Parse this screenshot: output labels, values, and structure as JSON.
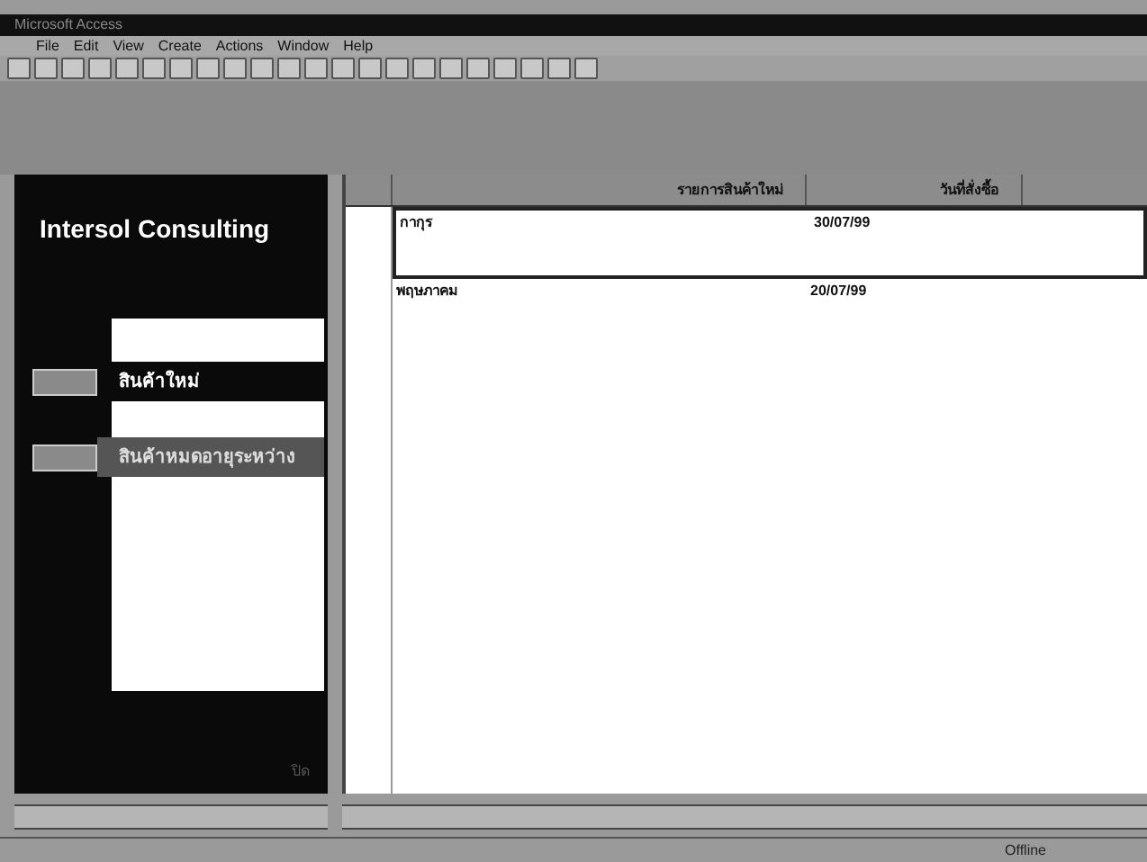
{
  "window": {
    "title": "Microsoft Access"
  },
  "menu": [
    "File",
    "Edit",
    "View",
    "Create",
    "Actions",
    "Window",
    "Help"
  ],
  "switchboard": {
    "title": "Intersol Consulting",
    "buttons": [
      {
        "label": "สินค้าใหม่",
        "selected": true
      },
      {
        "label": "สินค้าหมดอายุระหว่าง",
        "selected": false
      }
    ],
    "footer": "ปิด"
  },
  "table": {
    "columns": [
      "รายการสินค้าใหม่",
      "วันที่สั่งซื้อ"
    ],
    "rows": [
      {
        "cells": [
          "กากุร",
          "30/07/99"
        ],
        "selected": true
      },
      {
        "cells": [
          "พฤษภาคม",
          "20/07/99"
        ],
        "selected": false
      }
    ]
  },
  "status_bar": {
    "mode": "Offline"
  }
}
